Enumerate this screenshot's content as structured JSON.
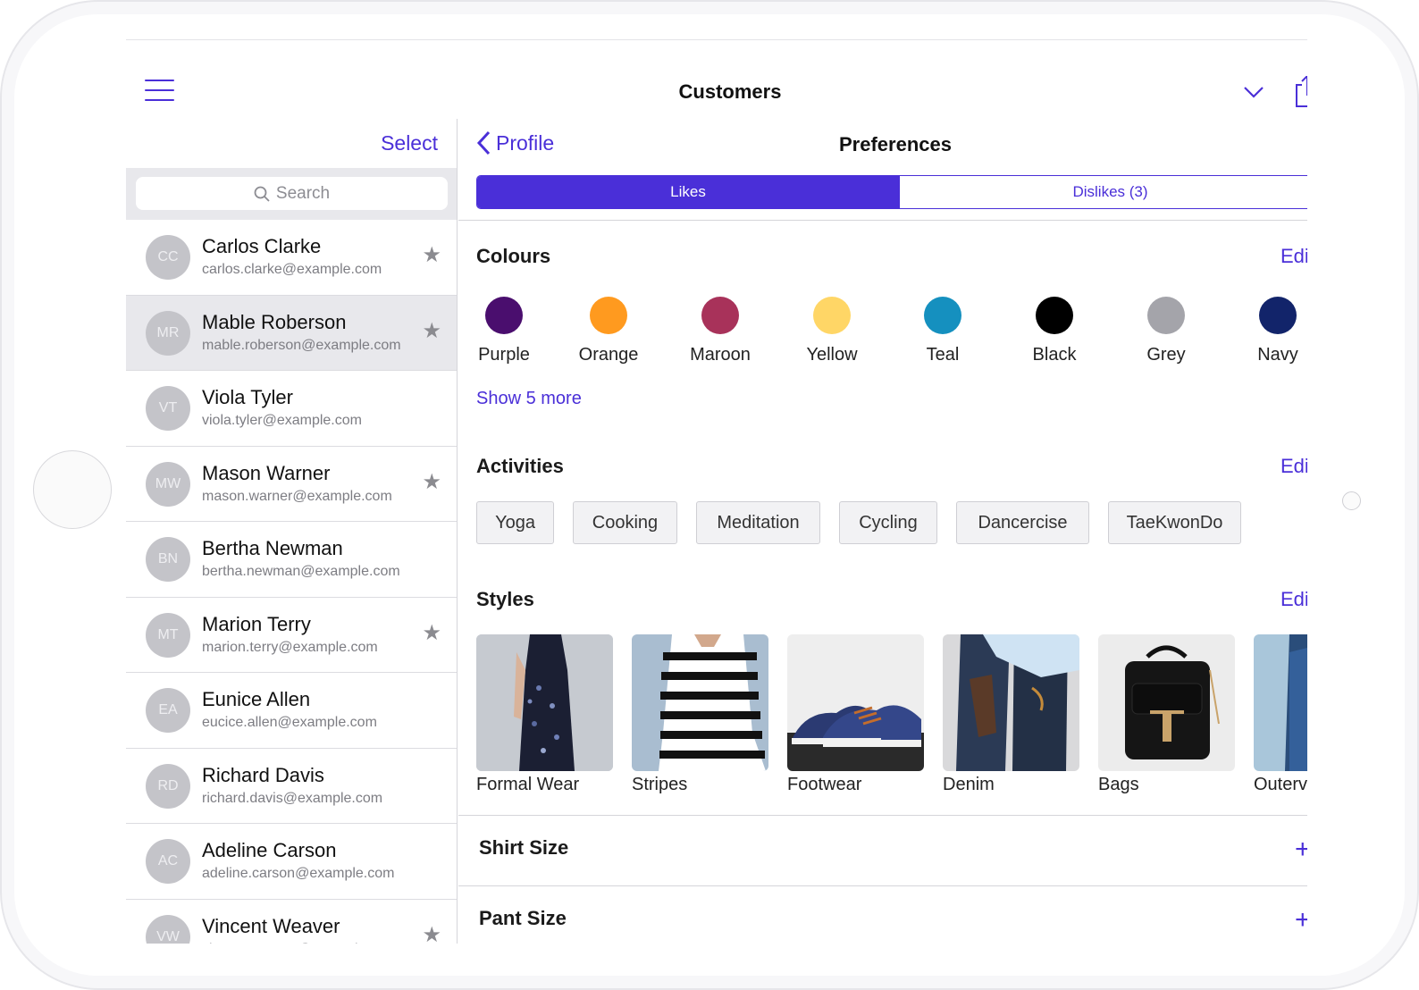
{
  "app": {
    "title": "Customers"
  },
  "list": {
    "select_label": "Select",
    "search_placeholder": "Search",
    "contacts": [
      {
        "initials": "CC",
        "name": "Carlos Clarke",
        "email": "carlos.clarke@example.com",
        "starred": true,
        "selected": false
      },
      {
        "initials": "MR",
        "name": "Mable Roberson",
        "email": "mable.roberson@example.com",
        "starred": true,
        "selected": true
      },
      {
        "initials": "VT",
        "name": "Viola Tyler",
        "email": "viola.tyler@example.com",
        "starred": false,
        "selected": false
      },
      {
        "initials": "MW",
        "name": "Mason Warner",
        "email": "mason.warner@example.com",
        "starred": true,
        "selected": false
      },
      {
        "initials": "BN",
        "name": "Bertha Newman",
        "email": "bertha.newman@example.com",
        "starred": false,
        "selected": false
      },
      {
        "initials": "MT",
        "name": "Marion Terry",
        "email": "marion.terry@example.com",
        "starred": true,
        "selected": false
      },
      {
        "initials": "EA",
        "name": "Eunice Allen",
        "email": "eucice.allen@example.com",
        "starred": false,
        "selected": false
      },
      {
        "initials": "RD",
        "name": "Richard Davis",
        "email": "richard.davis@example.com",
        "starred": false,
        "selected": false
      },
      {
        "initials": "AC",
        "name": "Adeline Carson",
        "email": "adeline.carson@example.com",
        "starred": false,
        "selected": false
      },
      {
        "initials": "VW",
        "name": "Vincent Weaver",
        "email": "vincent.weaver@example.com",
        "starred": true,
        "selected": false
      }
    ]
  },
  "detail": {
    "back_label": "Profile",
    "title": "Preferences",
    "tabs": [
      {
        "label": "Likes",
        "active": true
      },
      {
        "label": "Dislikes (3)",
        "active": false
      }
    ],
    "edit_label": "Edi",
    "colours": {
      "title": "Colours",
      "items": [
        {
          "name": "Purple",
          "hex": "#4a0e6e"
        },
        {
          "name": "Orange",
          "hex": "#ff9a1f"
        },
        {
          "name": "Maroon",
          "hex": "#a8325a"
        },
        {
          "name": "Yellow",
          "hex": "#ffd666"
        },
        {
          "name": "Teal",
          "hex": "#1590bf"
        },
        {
          "name": "Black",
          "hex": "#000000"
        },
        {
          "name": "Grey",
          "hex": "#a4a4aa"
        },
        {
          "name": "Navy",
          "hex": "#12246a"
        }
      ],
      "show_more": "Show 5 more"
    },
    "activities": {
      "title": "Activities",
      "items": [
        "Yoga",
        "Cooking",
        "Meditation",
        "Cycling",
        "Dancercise",
        "TaeKwonDo"
      ]
    },
    "styles": {
      "title": "Styles",
      "items": [
        "Formal Wear",
        "Stripes",
        "Footwear",
        "Denim",
        "Bags",
        "Outerv"
      ]
    },
    "sizes": [
      {
        "title": "Shirt Size",
        "action": "+"
      },
      {
        "title": "Pant Size",
        "action": "+"
      }
    ]
  },
  "colors": {
    "accent": "#4a2fd8",
    "selected_row": "#e8e8ec",
    "avatar": "#c4c4c9"
  }
}
